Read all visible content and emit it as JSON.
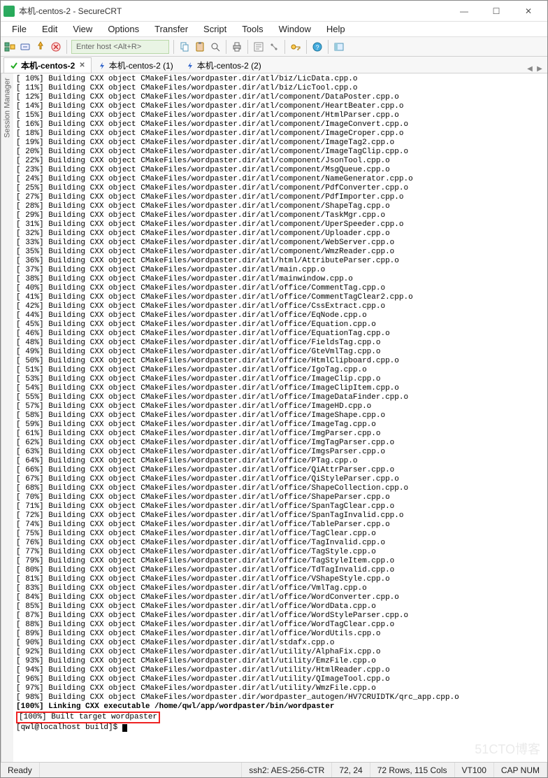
{
  "window": {
    "title": "本机-centos-2 - SecureCRT",
    "min": "—",
    "max": "☐",
    "close": "✕"
  },
  "menu": [
    "File",
    "Edit",
    "View",
    "Options",
    "Transfer",
    "Script",
    "Tools",
    "Window",
    "Help"
  ],
  "host_placeholder": "Enter host <Alt+R>",
  "tabs": [
    {
      "label": "本机-centos-2",
      "active": true,
      "icon": "check"
    },
    {
      "label": "本机-centos-2 (1)",
      "active": false,
      "icon": "link"
    },
    {
      "label": "本机-centos-2 (2)",
      "active": false,
      "icon": "link"
    }
  ],
  "sidebar_label": "Session Manager",
  "terminal_lines": [
    "[ 10%] Building CXX object CMakeFiles/wordpaster.dir/atl/biz/LicData.cpp.o",
    "[ 11%] Building CXX object CMakeFiles/wordpaster.dir/atl/biz/LicTool.cpp.o",
    "[ 12%] Building CXX object CMakeFiles/wordpaster.dir/atl/component/DataPoster.cpp.o",
    "[ 14%] Building CXX object CMakeFiles/wordpaster.dir/atl/component/HeartBeater.cpp.o",
    "[ 15%] Building CXX object CMakeFiles/wordpaster.dir/atl/component/HtmlParser.cpp.o",
    "[ 16%] Building CXX object CMakeFiles/wordpaster.dir/atl/component/ImageConvert.cpp.o",
    "[ 18%] Building CXX object CMakeFiles/wordpaster.dir/atl/component/ImageCroper.cpp.o",
    "[ 19%] Building CXX object CMakeFiles/wordpaster.dir/atl/component/ImageTag2.cpp.o",
    "[ 20%] Building CXX object CMakeFiles/wordpaster.dir/atl/component/ImageTagClip.cpp.o",
    "[ 22%] Building CXX object CMakeFiles/wordpaster.dir/atl/component/JsonTool.cpp.o",
    "[ 23%] Building CXX object CMakeFiles/wordpaster.dir/atl/component/MsgQueue.cpp.o",
    "[ 24%] Building CXX object CMakeFiles/wordpaster.dir/atl/component/NameGenerator.cpp.o",
    "[ 25%] Building CXX object CMakeFiles/wordpaster.dir/atl/component/PdfConverter.cpp.o",
    "[ 27%] Building CXX object CMakeFiles/wordpaster.dir/atl/component/PdfImporter.cpp.o",
    "[ 28%] Building CXX object CMakeFiles/wordpaster.dir/atl/component/ShapeTag.cpp.o",
    "[ 29%] Building CXX object CMakeFiles/wordpaster.dir/atl/component/TaskMgr.cpp.o",
    "[ 31%] Building CXX object CMakeFiles/wordpaster.dir/atl/component/UperSpeeder.cpp.o",
    "[ 32%] Building CXX object CMakeFiles/wordpaster.dir/atl/component/Uploader.cpp.o",
    "[ 33%] Building CXX object CMakeFiles/wordpaster.dir/atl/component/WebServer.cpp.o",
    "[ 35%] Building CXX object CMakeFiles/wordpaster.dir/atl/component/WmzReader.cpp.o",
    "[ 36%] Building CXX object CMakeFiles/wordpaster.dir/atl/html/AttributeParser.cpp.o",
    "[ 37%] Building CXX object CMakeFiles/wordpaster.dir/atl/main.cpp.o",
    "[ 38%] Building CXX object CMakeFiles/wordpaster.dir/atl/mainwindow.cpp.o",
    "[ 40%] Building CXX object CMakeFiles/wordpaster.dir/atl/office/CommentTag.cpp.o",
    "[ 41%] Building CXX object CMakeFiles/wordpaster.dir/atl/office/CommentTagClear2.cpp.o",
    "[ 42%] Building CXX object CMakeFiles/wordpaster.dir/atl/office/CssExtract.cpp.o",
    "[ 44%] Building CXX object CMakeFiles/wordpaster.dir/atl/office/EqNode.cpp.o",
    "[ 45%] Building CXX object CMakeFiles/wordpaster.dir/atl/office/Equation.cpp.o",
    "[ 46%] Building CXX object CMakeFiles/wordpaster.dir/atl/office/EquationTag.cpp.o",
    "[ 48%] Building CXX object CMakeFiles/wordpaster.dir/atl/office/FieldsTag.cpp.o",
    "[ 49%] Building CXX object CMakeFiles/wordpaster.dir/atl/office/GteVmlTag.cpp.o",
    "[ 50%] Building CXX object CMakeFiles/wordpaster.dir/atl/office/HtmlClipboard.cpp.o",
    "[ 51%] Building CXX object CMakeFiles/wordpaster.dir/atl/office/IgoTag.cpp.o",
    "[ 53%] Building CXX object CMakeFiles/wordpaster.dir/atl/office/ImageClip.cpp.o",
    "[ 54%] Building CXX object CMakeFiles/wordpaster.dir/atl/office/ImageClipItem.cpp.o",
    "[ 55%] Building CXX object CMakeFiles/wordpaster.dir/atl/office/ImageDataFinder.cpp.o",
    "[ 57%] Building CXX object CMakeFiles/wordpaster.dir/atl/office/ImageHD.cpp.o",
    "[ 58%] Building CXX object CMakeFiles/wordpaster.dir/atl/office/ImageShape.cpp.o",
    "[ 59%] Building CXX object CMakeFiles/wordpaster.dir/atl/office/ImageTag.cpp.o",
    "[ 61%] Building CXX object CMakeFiles/wordpaster.dir/atl/office/ImgParser.cpp.o",
    "[ 62%] Building CXX object CMakeFiles/wordpaster.dir/atl/office/ImgTagParser.cpp.o",
    "[ 63%] Building CXX object CMakeFiles/wordpaster.dir/atl/office/ImgsParser.cpp.o",
    "[ 64%] Building CXX object CMakeFiles/wordpaster.dir/atl/office/PTag.cpp.o",
    "[ 66%] Building CXX object CMakeFiles/wordpaster.dir/atl/office/QiAttrParser.cpp.o",
    "[ 67%] Building CXX object CMakeFiles/wordpaster.dir/atl/office/QiStyleParser.cpp.o",
    "[ 68%] Building CXX object CMakeFiles/wordpaster.dir/atl/office/ShapeCollection.cpp.o",
    "[ 70%] Building CXX object CMakeFiles/wordpaster.dir/atl/office/ShapeParser.cpp.o",
    "[ 71%] Building CXX object CMakeFiles/wordpaster.dir/atl/office/SpanTagClear.cpp.o",
    "[ 72%] Building CXX object CMakeFiles/wordpaster.dir/atl/office/SpanTagInvalid.cpp.o",
    "[ 74%] Building CXX object CMakeFiles/wordpaster.dir/atl/office/TableParser.cpp.o",
    "[ 75%] Building CXX object CMakeFiles/wordpaster.dir/atl/office/TagClear.cpp.o",
    "[ 76%] Building CXX object CMakeFiles/wordpaster.dir/atl/office/TagInvalid.cpp.o",
    "[ 77%] Building CXX object CMakeFiles/wordpaster.dir/atl/office/TagStyle.cpp.o",
    "[ 79%] Building CXX object CMakeFiles/wordpaster.dir/atl/office/TagStyleItem.cpp.o",
    "[ 80%] Building CXX object CMakeFiles/wordpaster.dir/atl/office/TdTagInvalid.cpp.o",
    "[ 81%] Building CXX object CMakeFiles/wordpaster.dir/atl/office/VShapeStyle.cpp.o",
    "[ 83%] Building CXX object CMakeFiles/wordpaster.dir/atl/office/VmlTag.cpp.o",
    "[ 84%] Building CXX object CMakeFiles/wordpaster.dir/atl/office/WordConverter.cpp.o",
    "[ 85%] Building CXX object CMakeFiles/wordpaster.dir/atl/office/WordData.cpp.o",
    "[ 87%] Building CXX object CMakeFiles/wordpaster.dir/atl/office/WordStyleParser.cpp.o",
    "[ 88%] Building CXX object CMakeFiles/wordpaster.dir/atl/office/WordTagClear.cpp.o",
    "[ 89%] Building CXX object CMakeFiles/wordpaster.dir/atl/office/WordUtils.cpp.o",
    "[ 90%] Building CXX object CMakeFiles/wordpaster.dir/atl/stdafx.cpp.o",
    "[ 92%] Building CXX object CMakeFiles/wordpaster.dir/atl/utility/AlphaFix.cpp.o",
    "[ 93%] Building CXX object CMakeFiles/wordpaster.dir/atl/utility/EmzFile.cpp.o",
    "[ 94%] Building CXX object CMakeFiles/wordpaster.dir/atl/utility/HtmlReader.cpp.o",
    "[ 96%] Building CXX object CMakeFiles/wordpaster.dir/atl/utility/QImageTool.cpp.o",
    "[ 97%] Building CXX object CMakeFiles/wordpaster.dir/atl/utility/WmzFile.cpp.o",
    "[ 98%] Building CXX object CMakeFiles/wordpaster.dir/wordpaster_autogen/HV7CRUIDTK/qrc_app.cpp.o"
  ],
  "terminal_linking": "[100%] Linking CXX executable /home/qwl/app/wordpaster/bin/wordpaster",
  "terminal_built": "[100%] Built target wordpaster",
  "terminal_prompt": "[qwl@localhost build]$ ",
  "status": {
    "ready": "Ready",
    "ssh": "ssh2: AES-256-CTR",
    "pos": "72,  24",
    "size": "72 Rows, 115 Cols",
    "term": "VT100",
    "caps": "CAP  NUM"
  },
  "watermark": "51CTO博客"
}
